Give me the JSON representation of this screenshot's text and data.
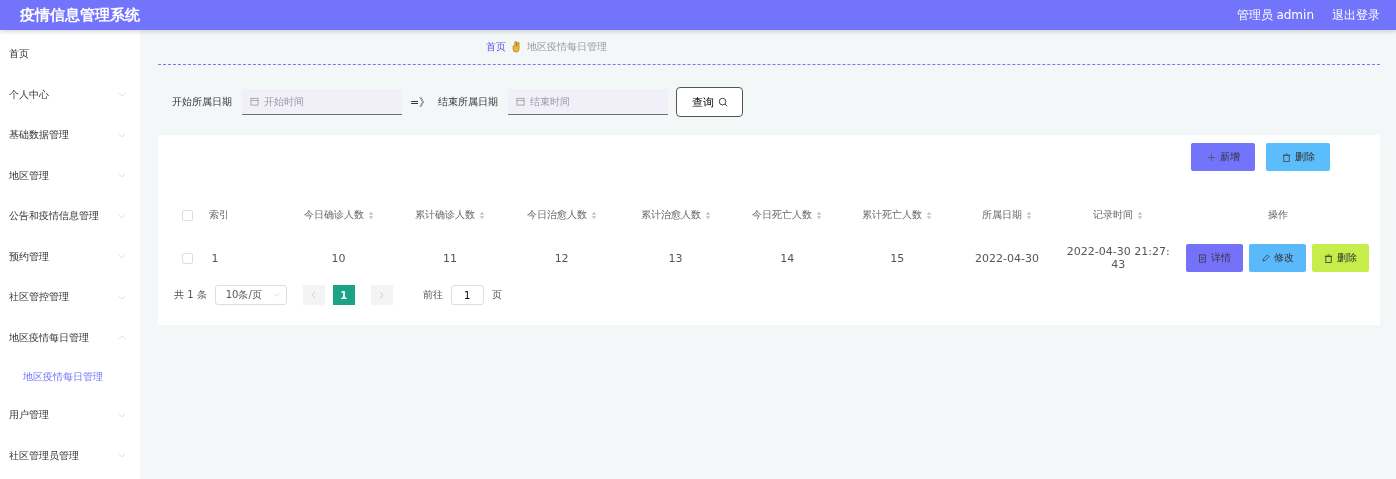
{
  "header": {
    "title": "疫情信息管理系统",
    "user": "管理员 admin",
    "logout": "退出登录"
  },
  "sidebar": {
    "items": [
      {
        "label": "首页",
        "has_arrow": false
      },
      {
        "label": "个人中心",
        "has_arrow": true,
        "expanded": false
      },
      {
        "label": "基础数据管理",
        "has_arrow": true,
        "expanded": false
      },
      {
        "label": "地区管理",
        "has_arrow": true,
        "expanded": false
      },
      {
        "label": "公告和疫情信息管理",
        "has_arrow": true,
        "expanded": false
      },
      {
        "label": "预约管理",
        "has_arrow": true,
        "expanded": false
      },
      {
        "label": "社区管控管理",
        "has_arrow": true,
        "expanded": false
      },
      {
        "label": "地区疫情每日管理",
        "has_arrow": true,
        "expanded": true,
        "children": [
          {
            "label": "地区疫情每日管理",
            "selected": true
          }
        ]
      },
      {
        "label": "用户管理",
        "has_arrow": true,
        "expanded": false
      },
      {
        "label": "社区管理员管理",
        "has_arrow": true,
        "expanded": false
      }
    ]
  },
  "breadcrumb": {
    "home": "首页",
    "current": "地区疫情每日管理"
  },
  "search": {
    "start_label": "开始所属日期",
    "start_placeholder": "开始时间",
    "separator": "=》",
    "end_label": "结束所属日期",
    "end_placeholder": "结束时间",
    "button": "查询"
  },
  "actions": [
    {
      "kind": "add",
      "label": "新增"
    },
    {
      "kind": "delete",
      "label": "删除"
    }
  ],
  "table": {
    "columns": [
      {
        "label": "索引",
        "sortable": false
      },
      {
        "label": "今日确诊人数",
        "sortable": true
      },
      {
        "label": "累计确诊人数",
        "sortable": true
      },
      {
        "label": "今日治愈人数",
        "sortable": true
      },
      {
        "label": "累计治愈人数",
        "sortable": true
      },
      {
        "label": "今日死亡人数",
        "sortable": true
      },
      {
        "label": "累计死亡人数",
        "sortable": true
      },
      {
        "label": "所属日期",
        "sortable": true
      },
      {
        "label": "记录时间",
        "sortable": true
      },
      {
        "label": "操作",
        "sortable": false
      }
    ],
    "header_checked": false,
    "rows": [
      {
        "checked": false,
        "cells": [
          "1",
          "10",
          "11",
          "12",
          "13",
          "14",
          "15",
          "2022-04-30",
          "2022-04-30 21:27:43"
        ],
        "buttons": [
          {
            "kind": "detail",
            "label": "详情"
          },
          {
            "kind": "edit",
            "label": "修改"
          },
          {
            "kind": "delete",
            "label": "删除"
          }
        ]
      }
    ]
  },
  "pagination": {
    "total": "共 1 条",
    "page_size": "10条/页",
    "pages": [
      {
        "label": "1",
        "selected": true
      }
    ],
    "goto_label": "前往",
    "goto_value": "1",
    "goto_suffix": "页"
  }
}
